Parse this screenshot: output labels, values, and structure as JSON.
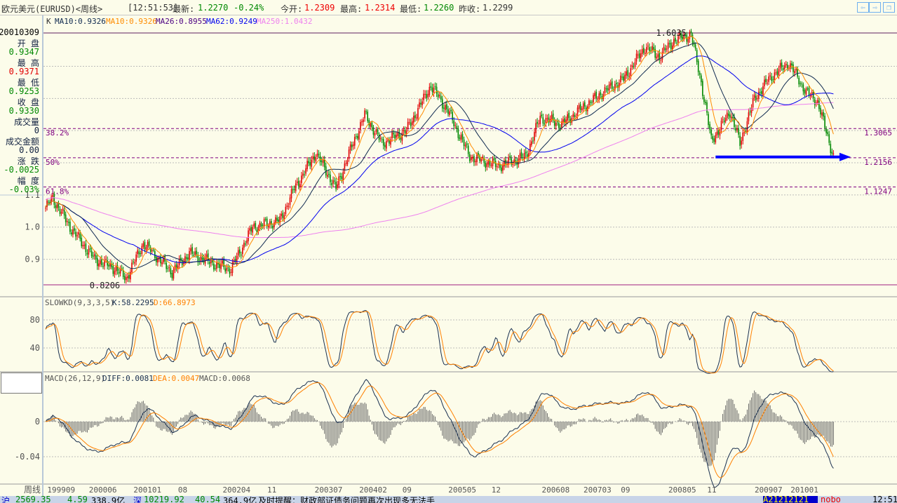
{
  "header": {
    "title": "欧元美元(EURUSD)<周线>",
    "time": "[12:51:53]",
    "latest_label": "最新:",
    "latest": "1.2270",
    "change": "-0.24%",
    "open_label": "今开:",
    "open": "1.2309",
    "high_label": "最高:",
    "high": "1.2314",
    "low_label": "最低:",
    "low": "1.2260",
    "prev_label": "昨收:",
    "prev": "1.2299"
  },
  "window_buttons": {
    "back": "⇦",
    "forward": "⇨",
    "restore": "❐"
  },
  "ma_legend": {
    "k": "K",
    "ma10a": "MA10:0.9326",
    "ma10b": "MA10:0.9326",
    "ma26": "MA26:0.8955",
    "ma62": "MA62:0.9249",
    "ma250": "MA250:1.0432"
  },
  "info": {
    "date": "20010309",
    "open_label": "开  盘",
    "open": "0.9347",
    "high_label": "最  高",
    "high": "0.9371",
    "low_label": "最  低",
    "low": "0.9253",
    "close_label": "收  盘",
    "close": "0.9330",
    "vol_label": "成交量",
    "vol": "0",
    "amount_label": "成交金额",
    "amount": "0.00",
    "chg_label": "涨  跌",
    "chg": "-0.0025",
    "pct_label": "幅  度",
    "pct": "-0.03%"
  },
  "colors": {
    "up": "#e00000",
    "down": "#008800",
    "ma10": "#102a50",
    "ma10b": "#ff8c00",
    "ma26": "#4b0082",
    "ma62": "#0000ee",
    "ma250": "#ee82ee",
    "fib": "#800080",
    "arrow": "#0000ff"
  },
  "chart_data": [
    {
      "type": "candlestick",
      "title": "欧元美元(EURUSD)<周线>",
      "period": "weekly",
      "ylim": [
        0.8206,
        1.6035
      ],
      "yticks": [
        "1.1",
        "1.0",
        "0.9"
      ],
      "ytick_values": [
        1.1,
        1.0,
        0.9
      ],
      "high_label": "1.6035",
      "low_label": "0.8206",
      "high_week": 449,
      "low_week": 56,
      "close_anchors": [
        [
          0,
          1.06
        ],
        [
          5,
          1.09
        ],
        [
          17,
          1.0
        ],
        [
          34,
          0.9
        ],
        [
          49,
          0.87
        ],
        [
          56,
          0.84
        ],
        [
          68,
          0.95
        ],
        [
          88,
          0.86
        ],
        [
          100,
          0.92
        ],
        [
          120,
          0.88
        ],
        [
          129,
          0.87
        ],
        [
          144,
          1.0
        ],
        [
          163,
          1.02
        ],
        [
          173,
          1.12
        ],
        [
          188,
          1.23
        ],
        [
          202,
          1.12
        ],
        [
          212,
          1.24
        ],
        [
          222,
          1.35
        ],
        [
          234,
          1.26
        ],
        [
          251,
          1.3
        ],
        [
          268,
          1.44
        ],
        [
          280,
          1.36
        ],
        [
          295,
          1.22
        ],
        [
          315,
          1.19
        ],
        [
          334,
          1.22
        ],
        [
          344,
          1.34
        ],
        [
          359,
          1.32
        ],
        [
          373,
          1.37
        ],
        [
          388,
          1.42
        ],
        [
          402,
          1.46
        ],
        [
          417,
          1.56
        ],
        [
          427,
          1.53
        ],
        [
          437,
          1.58
        ],
        [
          449,
          1.6
        ],
        [
          456,
          1.45
        ],
        [
          463,
          1.27
        ],
        [
          468,
          1.3
        ],
        [
          476,
          1.36
        ],
        [
          483,
          1.26
        ],
        [
          493,
          1.4
        ],
        [
          505,
          1.47
        ],
        [
          517,
          1.51
        ],
        [
          529,
          1.42
        ],
        [
          537,
          1.39
        ],
        [
          544,
          1.28
        ],
        [
          548,
          1.22
        ]
      ],
      "ma_periods": [
        10,
        26,
        62,
        250
      ],
      "fibonacci": [
        {
          "label": "38.2%",
          "value": 1.3065,
          "value_label": "1.3065"
        },
        {
          "label": "50%",
          "value": 1.2156,
          "value_label": "1.2156"
        },
        {
          "label": "61.8%",
          "value": 1.1247,
          "value_label": "1.1247"
        }
      ],
      "arrow": {
        "from_week": 466,
        "to_week": 560,
        "price": 1.218
      },
      "xticks": [
        [
          "199909",
          7
        ],
        [
          "200006",
          36
        ],
        [
          "200101",
          67
        ],
        [
          "08",
          98
        ],
        [
          "200204",
          129
        ],
        [
          "11",
          160
        ],
        [
          "200307",
          193
        ],
        [
          "200402",
          224
        ],
        [
          "09",
          254
        ],
        [
          "200505",
          286
        ],
        [
          "12",
          316
        ],
        [
          "200608",
          351
        ],
        [
          "200703",
          380
        ],
        [
          "09",
          406
        ],
        [
          "200805",
          439
        ],
        [
          "11",
          466
        ],
        [
          "200907",
          499
        ],
        [
          "201001",
          524
        ]
      ],
      "xaxis_label": "周线"
    },
    {
      "type": "line",
      "title": "SLOWKD(9,3,3,5)",
      "k_label": "K:58.2295",
      "d_label": "D:66.8973",
      "ylim": [
        0,
        100
      ],
      "yticks": [
        "80",
        "40"
      ],
      "ytick_values": [
        80,
        40
      ]
    },
    {
      "type": "bar+line",
      "title": "MACD(26,12,9)",
      "diff_label": "DIFF:0.0081",
      "dea_label": "DEA:0.0047",
      "macd_label": "MACD:0.0068",
      "yticks": [
        "0",
        "-0.04"
      ],
      "ytick_values": [
        0,
        -0.04
      ]
    }
  ],
  "status": {
    "sh_icon": "沪",
    "sh": "2569.35",
    "sh_chg": "4.59",
    "sh_amt": "338.9亿",
    "sz_icon": "深",
    "sz": "10219.92",
    "sz_chg": "40.54",
    "sz_amt": "364.9亿",
    "news": "及时提醒：财政部证债务问题再次出现多无法手",
    "ticker": "A21212121",
    "net": "nobo",
    "time": "12:51"
  }
}
